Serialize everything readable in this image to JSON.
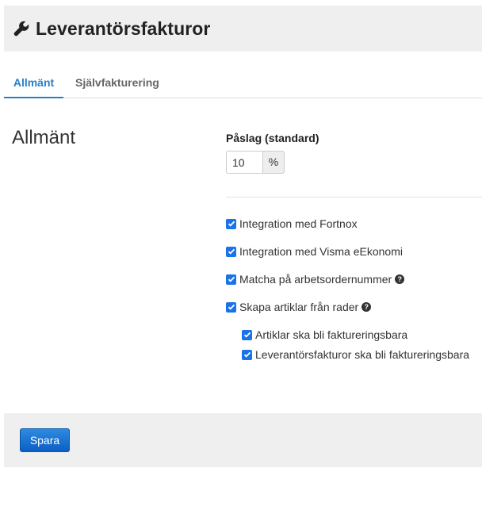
{
  "header": {
    "title": "Leverantörsfakturor",
    "icon": "wrench-icon"
  },
  "tabs": [
    {
      "label": "Allmänt",
      "active": true
    },
    {
      "label": "Självfakturering",
      "active": false
    }
  ],
  "section": {
    "title": "Allmänt",
    "markup_label": "Påslag (standard)",
    "markup_value": "10",
    "markup_unit": "%"
  },
  "options": [
    {
      "label": "Integration med Fortnox",
      "checked": true,
      "help": false
    },
    {
      "label": "Integration med Visma eEkonomi",
      "checked": true,
      "help": false
    },
    {
      "label": "Matcha på arbetsordernummer",
      "checked": true,
      "help": true
    },
    {
      "label": "Skapa artiklar från rader",
      "checked": true,
      "help": true
    }
  ],
  "sub_options": [
    {
      "label": "Artiklar ska bli faktureringsbara",
      "checked": true
    },
    {
      "label": "Leverantörsfakturor ska bli faktureringsbara",
      "checked": true
    }
  ],
  "footer": {
    "save_label": "Spara"
  },
  "colors": {
    "accent": "#2a7ec8",
    "checkbox": "#1a73e8",
    "button": "#0b5fc4"
  }
}
